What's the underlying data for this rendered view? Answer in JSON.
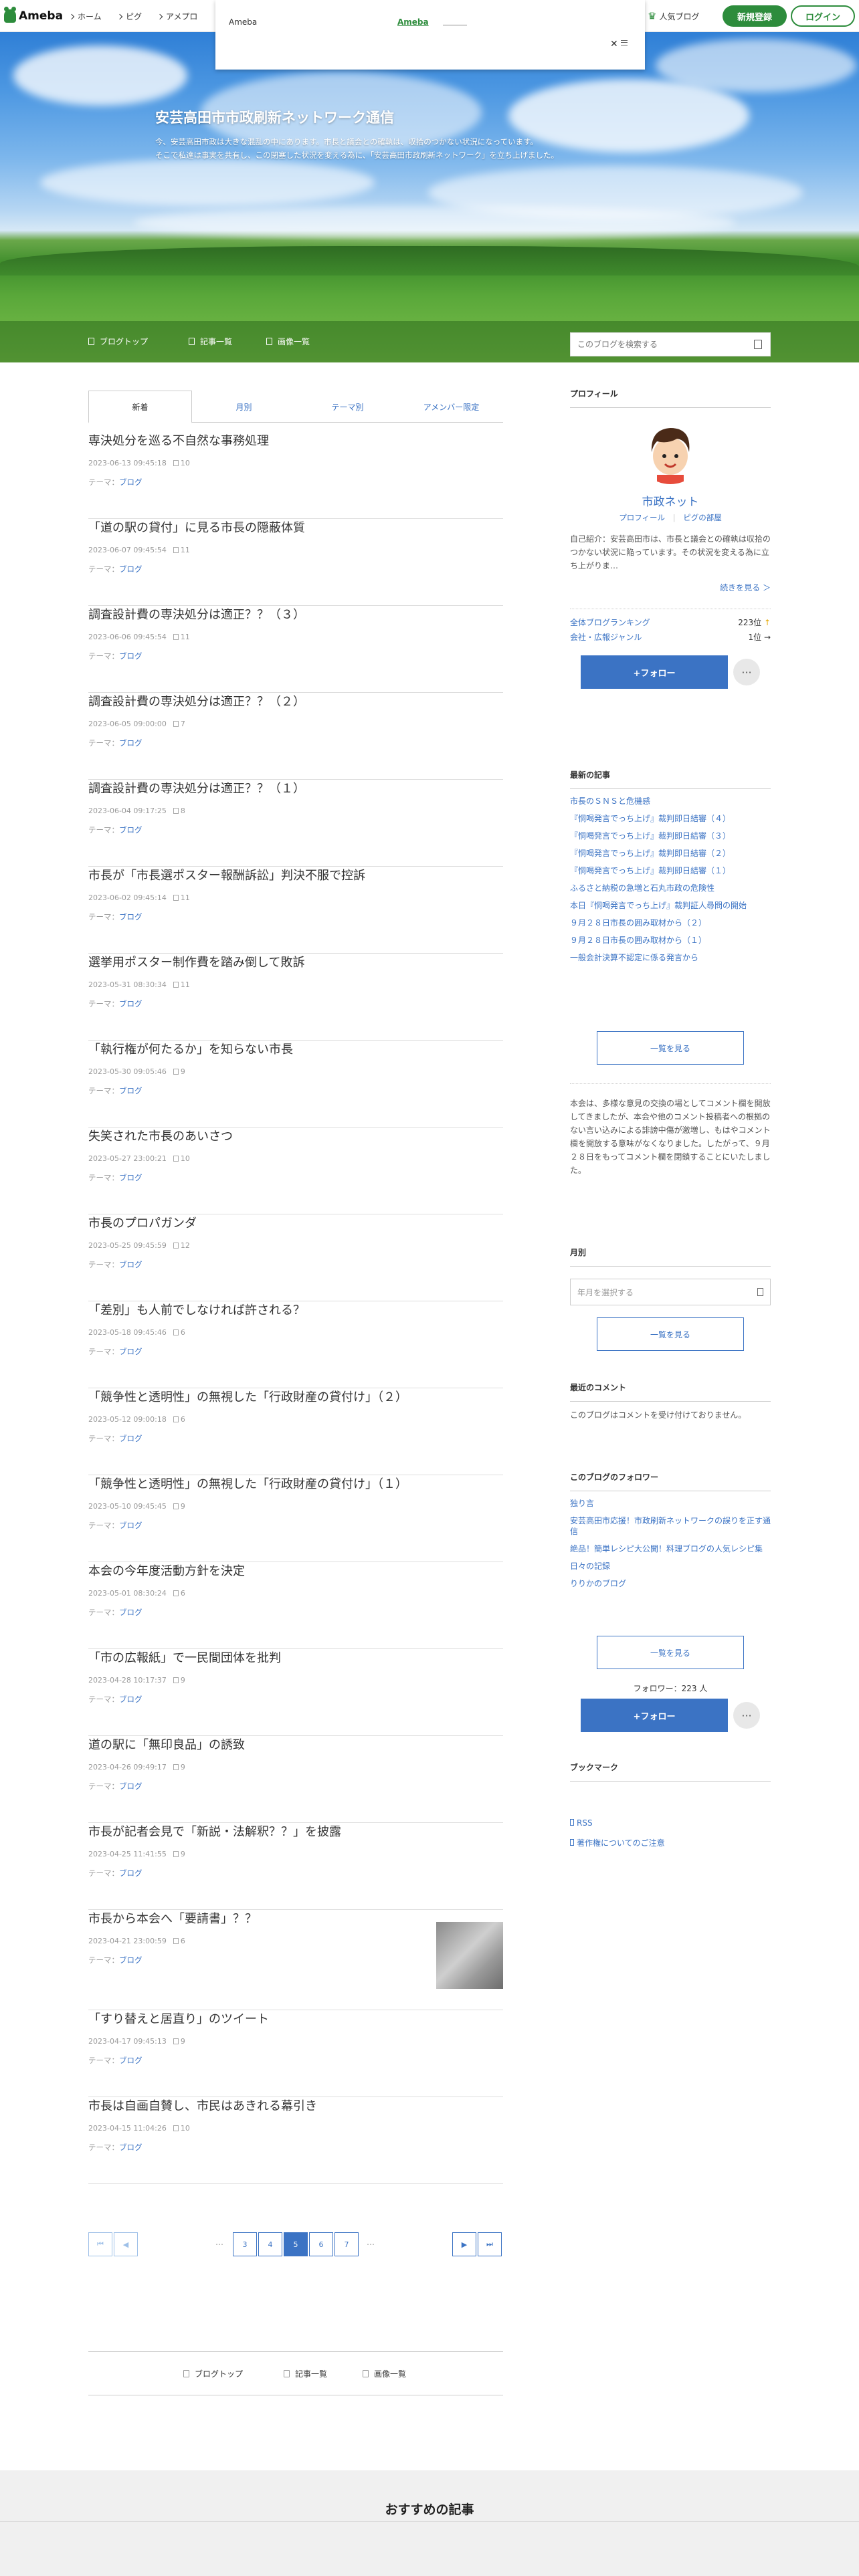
{
  "topbar": {
    "logo": "Ameba",
    "nav": [
      "ホーム",
      "ピグ",
      "アメプロ"
    ],
    "popup_brand": "Ameba",
    "popup_link": "Ameba",
    "popup_close": "✕",
    "popular_blog": "人気ブログ",
    "register": "新規登録",
    "login": "ログイン"
  },
  "hero": {
    "title": "安芸高田市市政刷新ネットワーク通信",
    "desc_line1": "今、安芸高田市政は大きな混乱の中にあります。市長と議会との確執は、収拾のつかない状況になっています。",
    "desc_line2": "そこで私達は事実を共有し、この閉塞した状況を変える為に、「安芸高田市政刷新ネットワーク」を立ち上げました。",
    "nav": [
      "ブログトップ",
      "記事一覧",
      "画像一覧"
    ],
    "search_placeholder": "このブログを検索する"
  },
  "tabs": [
    "新着",
    "月別",
    "テーマ別",
    "アメンバー限定"
  ],
  "theme_label": "テーマ：",
  "theme_value": "ブログ",
  "entries": [
    {
      "title": "専決処分を巡る不自然な事務処理",
      "date": "2023-06-13 09:45:18",
      "comments": "10"
    },
    {
      "title": "「道の駅の貸付」に見る市長の隠蔽体質",
      "date": "2023-06-07 09:45:54",
      "comments": "11"
    },
    {
      "title": "調査設計費の専決処分は適正？？（３）",
      "date": "2023-06-06 09:45:54",
      "comments": "11"
    },
    {
      "title": "調査設計費の専決処分は適正？？（２）",
      "date": "2023-06-05 09:00:00",
      "comments": "7"
    },
    {
      "title": "調査設計費の専決処分は適正？？（１）",
      "date": "2023-06-04 09:17:25",
      "comments": "8"
    },
    {
      "title": "市長が「市長選ポスター報酬訴訟」判決不服で控訴",
      "date": "2023-06-02 09:45:14",
      "comments": "11"
    },
    {
      "title": "選挙用ポスター制作費を踏み倒して敗訴",
      "date": "2023-05-31 08:30:34",
      "comments": "11"
    },
    {
      "title": "「執行権が何たるか」を知らない市長",
      "date": "2023-05-30 09:05:46",
      "comments": "9"
    },
    {
      "title": "失笑された市長のあいさつ",
      "date": "2023-05-27 23:00:21",
      "comments": "10"
    },
    {
      "title": "市長のプロパガンダ",
      "date": "2023-05-25 09:45:59",
      "comments": "12"
    },
    {
      "title": "「差別」も人前でしなければ許される？",
      "date": "2023-05-18 09:45:46",
      "comments": "6"
    },
    {
      "title": "「競争性と透明性」の無視した「行政財産の貸付け」（２）",
      "date": "2023-05-12 09:00:18",
      "comments": "6"
    },
    {
      "title": "「競争性と透明性」の無視した「行政財産の貸付け」（１）",
      "date": "2023-05-10 09:45:45",
      "comments": "9"
    },
    {
      "title": "本会の今年度活動方針を決定",
      "date": "2023-05-01 08:30:24",
      "comments": "6"
    },
    {
      "title": "「市の広報紙」で一民間団体を批判",
      "date": "2023-04-28 10:17:37",
      "comments": "9"
    },
    {
      "title": "道の駅に「無印良品」の誘致",
      "date": "2023-04-26 09:49:17",
      "comments": "9"
    },
    {
      "title": "市長が記者会見で「新説・法解釈？？」を披露",
      "date": "2023-04-25 11:41:55",
      "comments": "9"
    },
    {
      "title": "市長から本会へ「要請書」？？",
      "date": "2023-04-21 23:00:59",
      "comments": "6"
    },
    {
      "title": "「すり替えと居直り」のツイート",
      "date": "2023-04-17 09:45:13",
      "comments": "9"
    },
    {
      "title": "市長は自画自賛し、市民はあきれる幕引き",
      "date": "2023-04-15 11:04:26",
      "comments": "10"
    }
  ],
  "pager": {
    "dots": "…",
    "pages": [
      "3",
      "4",
      "5",
      "6",
      "7"
    ],
    "current": "5"
  },
  "footer_nav": [
    "ブログトップ",
    "記事一覧",
    "画像一覧"
  ],
  "reco_title": "おすすめの記事",
  "sidebar": {
    "profile_head": "プロフィール",
    "name": "市政ネット",
    "profile_link": "プロフィール",
    "pig_link": "ピグの部屋",
    "intro": "自己紹介：安芸高田市は、市長と議会との確執は収拾のつかない状況に陥っています。その状況を変える為に立ち上がりま…",
    "read_more": "続きを見る ＞",
    "ranking_label": "全体ブログランキング",
    "ranking_value": "223位",
    "ranking_arrow": "↑",
    "genre_label": "会社・広報ジャンル",
    "genre_value": "1位",
    "genre_arrow": "→",
    "follow": "+フォロー",
    "more": "···",
    "latest_head": "最新の記事",
    "latest": [
      "市長のＳＮＳと危機感",
      "『恫喝発言でっち上げ』裁判即日結審（４）",
      "『恫喝発言でっち上げ』裁判即日結審（３）",
      "『恫喝発言でっち上げ』裁判即日結審（２）",
      "『恫喝発言でっち上げ』裁判即日結審（１）",
      "ふるさと納税の急増と石丸市政の危険性",
      "本日『恫喝発言でっち上げ』裁判証人尋問の開始",
      "９月２８日市長の囲み取材から（２）",
      "９月２８日市長の囲み取材から（１）",
      "一般会計決算不認定に係る発言から"
    ],
    "list_all": "一覧を見る",
    "notice": "本会は、多様な意見の交換の場としてコメント欄を開放してきましたが、本会や他のコメント投稿者への根拠のない言い込みによる誹謗中傷が激増し、もはやコメント欄を開放する意味がなくなりました。したがって、９月２８日をもってコメント欄を閉鎖することにいたしました。",
    "monthly_head": "月別",
    "month_select": "年月を選択する",
    "comment_head": "最近のコメント",
    "comment_text": "このブログはコメントを受け付けておりません。",
    "followers_head": "このブログのフォロワー",
    "followers": [
      "独り言",
      "安芸高田市応援！市政刷新ネットワークの誤りを正す通信",
      "絶品！簡単レシピ大公開！料理ブログの人気レシピ集",
      "日々の記録",
      "りりかのブログ"
    ],
    "follower_count": "フォロワー：223 人",
    "bookmark_head": "ブックマーク",
    "rss": "RSS",
    "copyright": "著作権についてのご注意"
  },
  "colors": {
    "ameba_green": "#2d8c3c",
    "link_blue": "#3b73c4"
  }
}
